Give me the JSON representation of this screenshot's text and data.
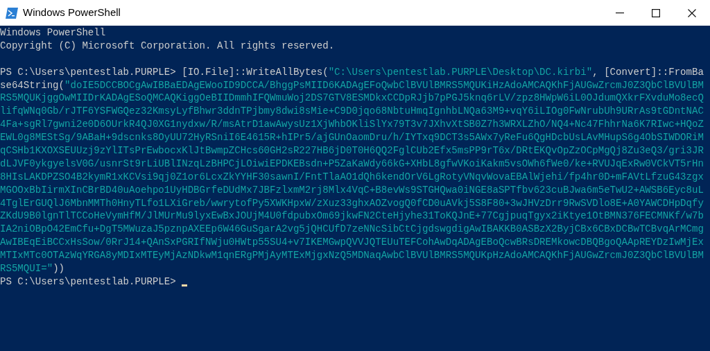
{
  "window": {
    "title": "Windows PowerShell"
  },
  "console": {
    "banner": [
      "Windows PowerShell",
      "Copyright (C) Microsoft Corporation. All rights reserved."
    ],
    "lines": [
      {
        "segments": [
          {
            "kind": "prompt",
            "text": "PS C:\\Users\\pentestlab.PURPLE> "
          },
          {
            "kind": "code",
            "text": "[IO.File]::WriteAllBytes("
          },
          {
            "kind": "string",
            "text": "\"C:\\Users\\pentestlab.PURPLE\\Desktop\\DC.kirbi\""
          },
          {
            "kind": "code",
            "text": ", [Convert]::FromBa"
          }
        ]
      },
      {
        "segments": [
          {
            "kind": "code",
            "text": "se64String("
          },
          {
            "kind": "string",
            "text": "\"doIE5DCCBOCgAwIBBaEDAgEWooID9DCCA/BhggPsMIID6KADAgEFoQwbClBVUlBMRS5MQUKiHzAdoAMCAQKhFjAUGwZrcmJ0Z3QbClBVUlBM"
          }
        ]
      },
      {
        "segments": [
          {
            "kind": "string",
            "text": "RS5MQUKjggOwMIIDrKADAgESoQMCAQKiggOeBIIDmmhIFQWmuWoj2DS7GTV8ESMDkxCCDpRJjb7pPGJ5knq6rLV/zpz8HWpW6iL0OJdumQXkrFXvduMo8ecQ"
          }
        ]
      },
      {
        "segments": [
          {
            "kind": "string",
            "text": "lifqWNq0Gb/rJTF6YSFWGQez32KmsyLyfBhwr3ddnTPjbmy8dwi8sMie+C9D0jqo68NbtuHmqIgnhbLNQa63M9+vqY6iLIOg0FwNrubUh9URrAs9tGDntNAC"
          }
        ]
      },
      {
        "segments": [
          {
            "kind": "string",
            "text": "4Fa+sgRl7gwni2e0D6OUrkR4QJ0XG1nydxw/R/msAtrD1awAwysUz1XjWhbOKliSlYx79T3v7JXhvXtSB0Z7h3WRXLZhO/NQ4+Nc47FhhrNa6K7RIwc+HQoZ"
          }
        ]
      },
      {
        "segments": [
          {
            "kind": "string",
            "text": "EWL0g8MEStSg/9ABaH+9dscnks8OyUU72HyRSniI6E4615R+hIPr5/ajGUnOaomDru/h/IYTxq9DCT3s5AWx7yReFu6QgHDcbUsLAvMHupS6g4ObSIWDORiM"
          }
        ]
      },
      {
        "segments": [
          {
            "kind": "string",
            "text": "qCSHb1KXOXSEUUzj9zYlITsPrEwbocxKlJtBwmpZCHcs60GH2sR227HB6jD0T0H6QQ2FglCUb2Efx5msPP9rT6x/DRtEKQvOpZzOCpMgQj8Zu3eQ3/gri3JR"
          }
        ]
      },
      {
        "segments": [
          {
            "kind": "string",
            "text": "dLJVF0ykgyelsV0G/usnrSt9rLiUBlINzqLzBHPCjLOiwiEPDKEBsdn+P5ZaKaWdy66kG+XHbL8gfwVKoiKakm5vsOWh6fWe0/ke+RVUJqExRw0VCkVT5rHn"
          }
        ]
      },
      {
        "segments": [
          {
            "kind": "string",
            "text": "8HIsLAKDPZSO4B2kymR1xKCVsi9qj0Z1or6LcxZkYYHF30sawnI/FntTlaAO1dQh6kendOrV6LgRotyVNqvWovaEBAlWjehi/fp4hr0D+mFAVtLfzuG43zgx"
          }
        ]
      },
      {
        "segments": [
          {
            "kind": "string",
            "text": "MGOOxBbIirmXInCBrBD40uAoehpo1UyHDBGrfeDUdMx7JBFzlxmM2rj8Mlx4VqC+B8evWs9STGHQwa0iNGE8aSPTfbv623cuBJwa6m5eTwU2+AWSB6Eyc8uL"
          }
        ]
      },
      {
        "segments": [
          {
            "kind": "string",
            "text": "4TglErGUQlJ6MbnMMTh0HnyTLfo1LXiGreb/wwrytofPy5XWKHpxW/zXuz33ghxAOZvogQ0fCD0uAVkj5S8F80+3wJHVzDrr9RwSVDlo8E+A0YAWCDHpDqfy"
          }
        ]
      },
      {
        "segments": [
          {
            "kind": "string",
            "text": "ZKdU9B0lgnTlTCCoHeVymHfM/JlMUrMu9lyxEwBxJOUjM4U0fdpubxOm69jkwFN2CteHjyhe31ToKQJnE+77CgjpuqTgyx2iKtye1OtBMN376FECMNKf/w7b"
          }
        ]
      },
      {
        "segments": [
          {
            "kind": "string",
            "text": "IA2niOBpO42EmCfu+DgT5MWuzaJ5pznpAXEEp6W46GuSgarA2vg5jQHCUfD7zeNNcSibCtCjgdswgdigAwIBAKKB0ASBzX2ByjCBx6CBxDCBwTCBvqArMCmg"
          }
        ]
      },
      {
        "segments": [
          {
            "kind": "string",
            "text": "AwIBEqEiBCCxHsSow/0RrJ14+QAnSxPGRIfNWju0HWtp55SU4+v7IKEMGwpQVVJQTEUuTEFCohAwDqADAgEBoQcwBRsDREMkowcDBQBgoQAApREYDzIwMjEx"
          }
        ]
      },
      {
        "segments": [
          {
            "kind": "string",
            "text": "MTIxMTc0OTAzWqYRGA8yMDIxMTEyMjAzNDkwM1qnERgPMjAyMTExMjgxNzQ5MDNaqAwbClBVUlBMRS5MQUKpHzAdoAMCAQKhFjAUGwZrcmJ0Z3QbClBVUlBM"
          }
        ]
      },
      {
        "segments": [
          {
            "kind": "string",
            "text": "RS5MQUI=\""
          },
          {
            "kind": "code",
            "text": "))"
          }
        ]
      },
      {
        "segments": [
          {
            "kind": "prompt",
            "text": "PS C:\\Users\\pentestlab.PURPLE> "
          }
        ],
        "cursor": true
      }
    ]
  }
}
